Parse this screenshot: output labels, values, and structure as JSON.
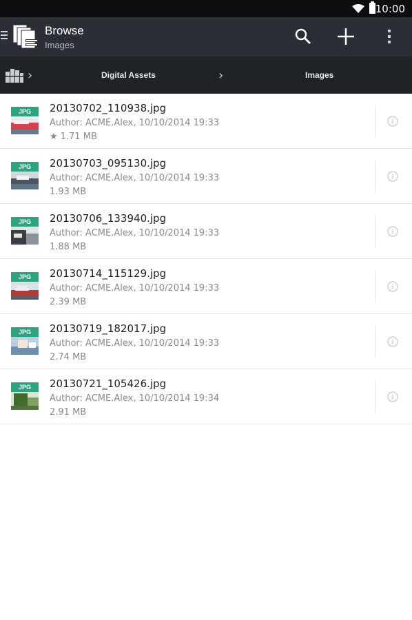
{
  "status_bar": {
    "time": "10:00"
  },
  "app_bar": {
    "title": "Browse",
    "subtitle": "Images"
  },
  "breadcrumb": {
    "items": [
      "Digital Assets",
      "Images"
    ]
  },
  "files": [
    {
      "name": "20130702_110938.jpg",
      "author_line": "Author: ACME.Alex, 10/10/2014 19:33",
      "size": "1.71 MB",
      "starred": true,
      "badge": "JPG"
    },
    {
      "name": "20130703_095130.jpg",
      "author_line": "Author: ACME.Alex, 10/10/2014 19:33",
      "size": "1.93 MB",
      "starred": false,
      "badge": "JPG"
    },
    {
      "name": "20130706_133940.jpg",
      "author_line": "Author: ACME.Alex, 10/10/2014 19:33",
      "size": "1.88 MB",
      "starred": false,
      "badge": "JPG"
    },
    {
      "name": "20130714_115129.jpg",
      "author_line": "Author: ACME.Alex, 10/10/2014 19:33",
      "size": "2.39 MB",
      "starred": false,
      "badge": "JPG"
    },
    {
      "name": "20130719_182017.jpg",
      "author_line": "Author: ACME.Alex, 10/10/2014 19:33",
      "size": "2.74 MB",
      "starred": false,
      "badge": "JPG"
    },
    {
      "name": "20130721_105426.jpg",
      "author_line": "Author: ACME.Alex, 10/10/2014 19:34",
      "size": "2.91 MB",
      "starred": false,
      "badge": "JPG"
    }
  ],
  "colors": {
    "app_bar": "#2a2e35",
    "breadcrumb_bar": "#1f2227",
    "badge": "#2fa37d"
  }
}
